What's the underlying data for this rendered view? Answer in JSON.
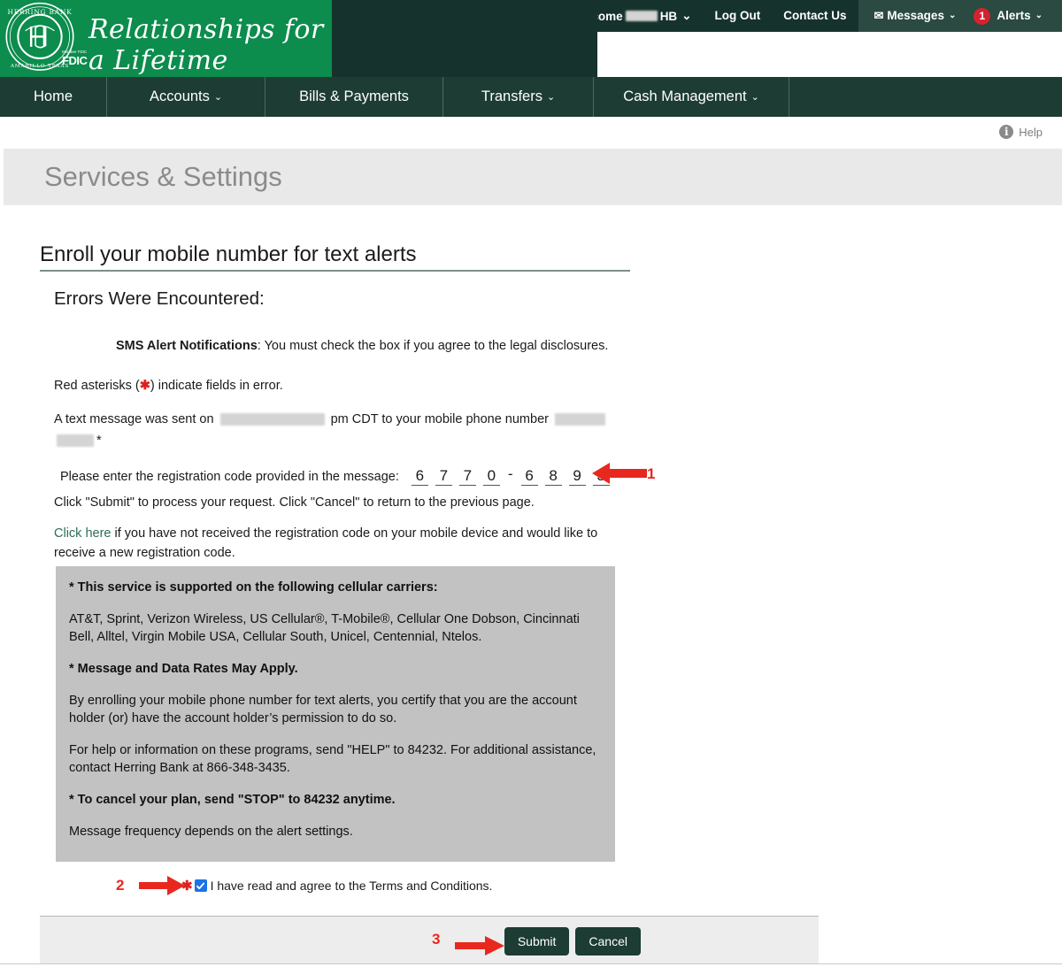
{
  "brand": {
    "bank_name": "HERRING BANK",
    "emblem_initials": "HB",
    "fdic_label": "FDIC",
    "fdic_sub": "Member FDIC",
    "tagline": "Relationships for a Lifetime",
    "green": "#0c8c4d",
    "dark_green": "#1c3c34"
  },
  "topbar": {
    "welcome_prefix": "Welcome",
    "welcome_suffix": "HB",
    "log_out": "Log Out",
    "contact_us": "Contact Us",
    "messages": "Messages",
    "messages_icon": "envelope-icon",
    "alerts": "Alerts",
    "alerts_count": "1",
    "caret": "⌄"
  },
  "nav": {
    "items": [
      {
        "label": "Home",
        "has_caret": false
      },
      {
        "label": "Accounts",
        "has_caret": true
      },
      {
        "label": "Bills & Payments",
        "has_caret": false
      },
      {
        "label": "Transfers",
        "has_caret": true
      },
      {
        "label": "Cash Management",
        "has_caret": true
      }
    ],
    "caret": "⌄"
  },
  "help": {
    "label": "Help",
    "icon": "info-icon"
  },
  "page": {
    "title": "Services & Settings",
    "section_heading": "Enroll your mobile number for text alerts",
    "errors_heading": "Errors Were Encountered:",
    "error_bold": "SMS Alert Notifications",
    "error_rest": ": You must check the box if you agree to the legal disclosures.",
    "asterisk_note_before": "Red asterisks (",
    "asterisk_note_mark": "✱",
    "asterisk_note_after": ") indicate fields in error.",
    "sent_note_1": "A text message was sent on",
    "sent_note_2": "pm CDT to your mobile phone number",
    "sent_note_3": "*",
    "code_label": "Please enter the registration code provided in the message:",
    "code_digits_1": [
      "6",
      "7",
      "7",
      "0"
    ],
    "code_separator": "-",
    "code_digits_2": [
      "6",
      "8",
      "9",
      "3"
    ],
    "submit_note": "Click \"Submit\" to process your request. Click \"Cancel\" to return to the previous page.",
    "resend_link": "Click here",
    "resend_rest": " if you have not received the registration code on your mobile device and would like to receive a new registration code."
  },
  "disclosure": {
    "carriers_heading": "* This service is supported on the following cellular carriers:",
    "carriers_list": "AT&T, Sprint, Verizon Wireless, US Cellular®, T-Mobile®, Cellular One Dobson, Cincinnati Bell, Alltel, Virgin Mobile USA, Cellular South, Unicel, Centennial, Ntelos.",
    "rates_heading": "* Message and Data Rates May Apply.",
    "certify_text": "By enrolling your mobile phone number for text alerts, you certify that you are the account holder (or) have the account holder’s permission to do so.",
    "help_text": "For help or information on these programs, send \"HELP\" to 84232. For additional assistance, contact Herring Bank at 866-348-3435.",
    "cancel_heading": "* To cancel your plan, send \"STOP\" to 84232 anytime.",
    "frequency_text": "Message frequency depends on the alert settings."
  },
  "agree": {
    "asterisk": "✱",
    "checked": true,
    "label": "I have read and agree to the Terms and Conditions."
  },
  "buttons": {
    "submit": "Submit",
    "cancel": "Cancel"
  },
  "annotations": {
    "one": "1",
    "two": "2",
    "three": "3",
    "color": "#e8281e"
  }
}
